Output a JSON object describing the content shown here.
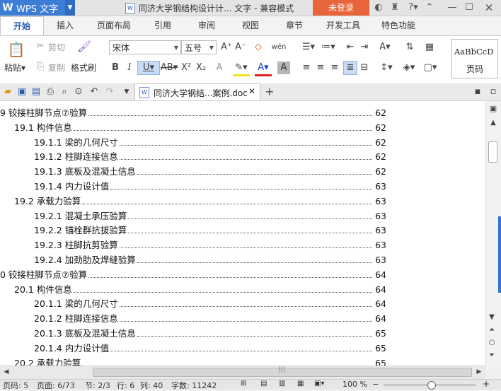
{
  "titlebar": {
    "app_name": "WPS 文字",
    "document_title": "同济大学钢结构设计计... 文字 - 兼容模式",
    "login_label": "未登录"
  },
  "tabs": [
    {
      "label": "开始",
      "active": true
    },
    {
      "label": "插入"
    },
    {
      "label": "页面布局"
    },
    {
      "label": "引用"
    },
    {
      "label": "审阅"
    },
    {
      "label": "视图"
    },
    {
      "label": "章节"
    },
    {
      "label": "开发工具"
    },
    {
      "label": "特色功能"
    }
  ],
  "ribbon": {
    "paste_label": "粘贴",
    "cut_label": "剪切",
    "copy_label": "复制",
    "format_painter_label": "格式刷",
    "font_name": "宋体",
    "font_size": "五号",
    "style_preview": "AaBbCcD",
    "style_name": "页码"
  },
  "doc_tab": {
    "label": "同济大学钢结...案例.doc"
  },
  "toc": [
    {
      "text": "9 铰接柱脚节点⑦验算",
      "page": "62"
    },
    {
      "text": "19.1 构件信息",
      "page": "62"
    },
    {
      "text": "19.1.1 梁的几何尺寸",
      "page": "62"
    },
    {
      "text": "19.1.2 柱脚连接信息",
      "page": "62"
    },
    {
      "text": "19.1.3 底板及混凝土信息",
      "page": "62"
    },
    {
      "text": "19.1.4 内力设计值",
      "page": "63"
    },
    {
      "text": "19.2 承载力验算",
      "page": "63"
    },
    {
      "text": "19.2.1 混凝土承压验算",
      "page": "63"
    },
    {
      "text": "19.2.2 锚栓群抗拔验算",
      "page": "63"
    },
    {
      "text": "19.2.3 柱脚抗剪验算",
      "page": "63"
    },
    {
      "text": "19.2.4 加劲肋及焊缝验算",
      "page": "63"
    },
    {
      "text": "0 铰接柱脚节点⑦验算",
      "page": "64"
    },
    {
      "text": "20.1 构件信息",
      "page": "64"
    },
    {
      "text": "20.1.1 梁的几何尺寸",
      "page": "64"
    },
    {
      "text": "20.1.2 柱脚连接信息",
      "page": "64"
    },
    {
      "text": "20.1.3 底板及混凝土信息",
      "page": "65"
    },
    {
      "text": "20.1.4 内力设计值",
      "page": "65"
    },
    {
      "text": "20.2 承载力验算",
      "page": "65"
    }
  ],
  "statusbar": {
    "page_num": "页码: 5",
    "page_of": "页面: 6/73",
    "section": "节: 2/3",
    "row": "行: 6",
    "col": "列: 40",
    "word_count": "字数: 11242",
    "zoom": "100 %"
  },
  "colors": {
    "accent": "#3c7dd6",
    "login": "#e8643a"
  }
}
